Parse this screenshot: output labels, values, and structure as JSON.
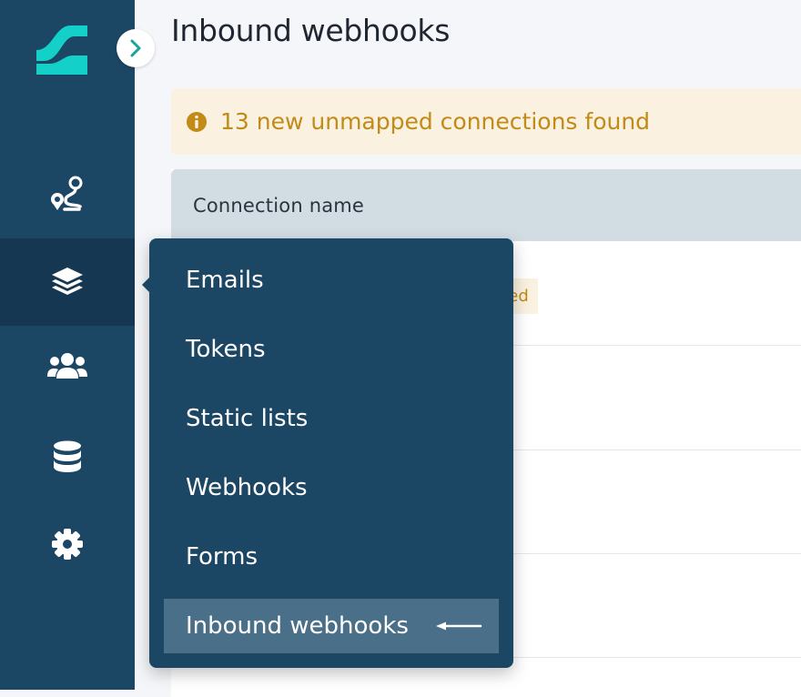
{
  "page": {
    "title": "Inbound webhooks"
  },
  "alert": {
    "icon": "info-icon",
    "text": "13 new unmapped connections found"
  },
  "table": {
    "columns": [
      "Connection name"
    ],
    "badge_fragment": "ed"
  },
  "sidebar": {
    "items": [
      {
        "name": "journeys",
        "icon": "route-icon"
      },
      {
        "name": "content",
        "icon": "layers-icon",
        "active": true
      },
      {
        "name": "contacts",
        "icon": "users-icon"
      },
      {
        "name": "data",
        "icon": "database-icon"
      },
      {
        "name": "settings",
        "icon": "gear-icon"
      }
    ]
  },
  "flyout": {
    "items": [
      {
        "label": "Emails"
      },
      {
        "label": "Tokens"
      },
      {
        "label": "Static lists"
      },
      {
        "label": "Webhooks"
      },
      {
        "label": "Forms"
      },
      {
        "label": "Inbound webhooks",
        "selected": true
      }
    ]
  },
  "colors": {
    "sidebar": "#1b4664",
    "sidebar_active": "#153751",
    "brand": "#13d0c8",
    "alert_bg": "#faf1e0",
    "alert_text": "#c28a16",
    "table_header": "#d2dde3",
    "menu_selected": "#4a6f89"
  }
}
